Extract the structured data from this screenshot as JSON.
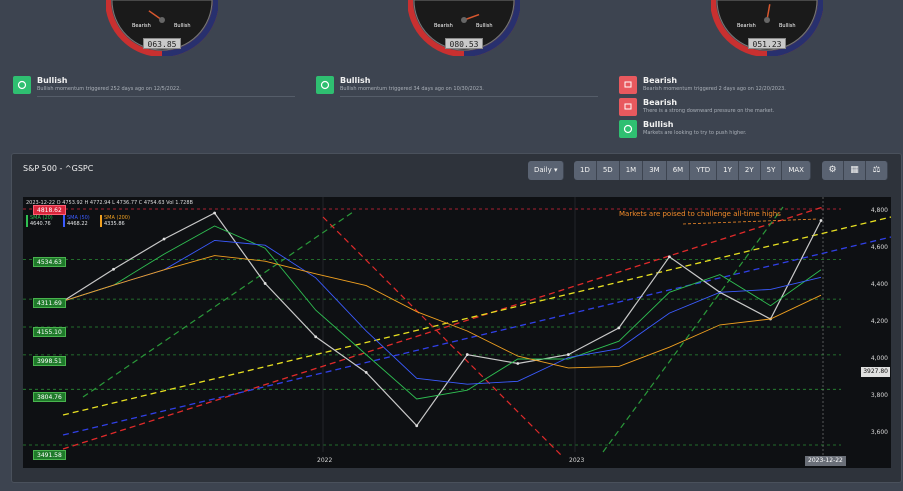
{
  "gauges": [
    {
      "readout": "063.85",
      "bear": "Bearish",
      "bull": "Bullish",
      "needle_deg": -55
    },
    {
      "readout": "080.53",
      "bear": "Bearish",
      "bull": "Bullish",
      "needle_deg": 70
    },
    {
      "readout": "051.23",
      "bear": "Bearish",
      "bull": "Bullish",
      "needle_deg": 10
    }
  ],
  "signals": [
    {
      "type": "Bullish",
      "desc": "Bullish momentum triggered 252 days ago on 12/5/2022.",
      "kind": "bull"
    },
    {
      "type": "Bullish",
      "desc": "Bullish momentum triggered 34 days ago on 10/30/2023.",
      "kind": "bull"
    },
    {
      "type": "Bearish",
      "desc": "Bearish momentum triggered 2 days ago on 12/20/2023.",
      "kind": "bear"
    },
    {
      "type": "Bearish",
      "desc": "There is a strong downward pressure on the market.",
      "kind": "bear"
    },
    {
      "type": "Bullish",
      "desc": "Markets are looking to try to push higher.",
      "kind": "bull"
    }
  ],
  "panel": {
    "title": "S&P 500 - ^GSPC",
    "interval": "Daily",
    "ranges": [
      "1D",
      "5D",
      "1M",
      "3M",
      "6M",
      "YTD",
      "1Y",
      "2Y",
      "5Y",
      "MAX"
    ]
  },
  "chart": {
    "ohlc_header": {
      "date": "2023-12-22",
      "o_label": "O",
      "o": "4753.92",
      "h_label": "H",
      "h": "4772.94",
      "l_label": "L",
      "l": "4736.77",
      "c_label": "C",
      "c": "4754.63",
      "vol_label": "Vol",
      "vol": "1.728B"
    },
    "legend": [
      {
        "name": "SMA (20)",
        "value": "4640.76",
        "color": "#2fbf52"
      },
      {
        "name": "SMA (50)",
        "value": "4468.22",
        "color": "#3b5bff"
      },
      {
        "name": "SMA (200)",
        "value": "4335.86",
        "color": "#f0a020"
      }
    ],
    "levels": [
      "4818.62",
      "4534.63",
      "4311.69",
      "4155.10",
      "3998.51",
      "3804.76",
      "3491.58"
    ],
    "y_ticks": [
      "4,800",
      "4,600",
      "4,400",
      "4,200",
      "4,000",
      "3,800",
      "3,600"
    ],
    "x_ticks": [
      "2022",
      "2023"
    ],
    "price_tag": "3927.80",
    "date_tag": "2023-12-22",
    "annotation": "Markets are poised to challenge all-time highs"
  },
  "chart_data": {
    "type": "line",
    "title": "S&P 500 - ^GSPC",
    "xlabel": "",
    "ylabel": "",
    "ylim": [
      3491.58,
      4818.62
    ],
    "x": [
      "2021-07",
      "2021-09",
      "2021-11",
      "2022-01",
      "2022-03",
      "2022-05",
      "2022-07",
      "2022-09",
      "2022-11",
      "2023-01",
      "2023-03",
      "2023-05",
      "2023-07",
      "2023-09",
      "2023-11",
      "2023-12-22"
    ],
    "series": [
      {
        "name": "",
        "values": [
          4300,
          4480,
          4650,
          4796,
          4400,
          4100,
          3900,
          3600,
          4000,
          3950,
          4000,
          4150,
          4550,
          4350,
          4200,
          4754
        ]
      }
    ]
  }
}
